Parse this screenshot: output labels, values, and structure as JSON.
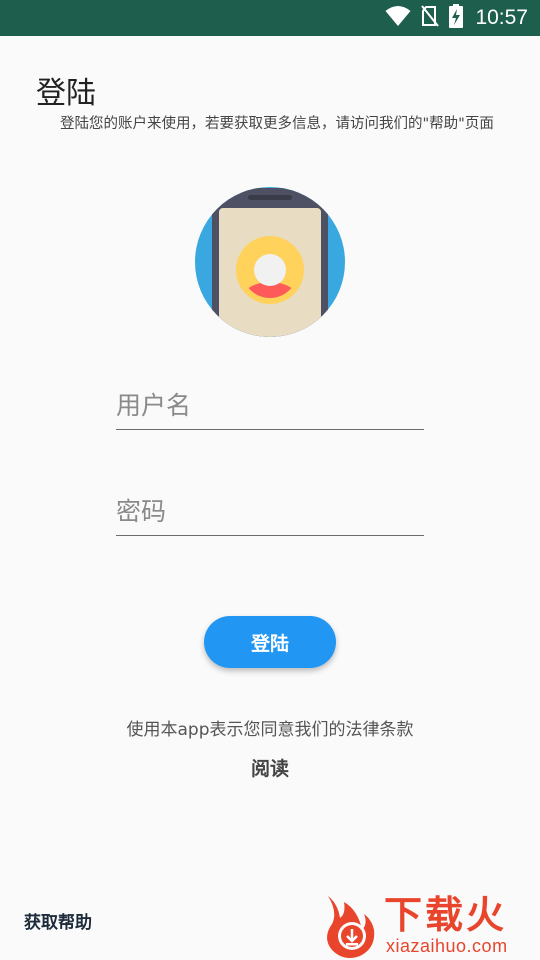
{
  "status_bar": {
    "time": "10:57",
    "icons": [
      "wifi-icon",
      "no-sim-icon",
      "battery-charging-icon"
    ],
    "background": "#1d5e4c"
  },
  "header": {
    "title": "登陆",
    "subtitle": "登陆您的账户来使用，若要获取更多信息，请访问我们的\"帮助\"页面"
  },
  "illustration": {
    "icon": "phone-user-avatar-icon",
    "colors": {
      "circle": "#3aa8e0",
      "phone": "#4e5163",
      "screen": "#e8dcc2",
      "avatar_ring": "#ffd25c",
      "avatar_body": "#ff5a5a"
    }
  },
  "form": {
    "username": {
      "placeholder": "用户名",
      "value": ""
    },
    "password": {
      "placeholder": "密码",
      "value": ""
    },
    "login_label": "登陆",
    "accent": "#2196f3"
  },
  "terms": {
    "text": "使用本app表示您同意我们的法律条款",
    "read_label": "阅读"
  },
  "footer": {
    "help_label": "获取帮助"
  },
  "watermark": {
    "brand": "下载火",
    "domain": "xiazaihuo.com",
    "color": "#e8452c"
  }
}
